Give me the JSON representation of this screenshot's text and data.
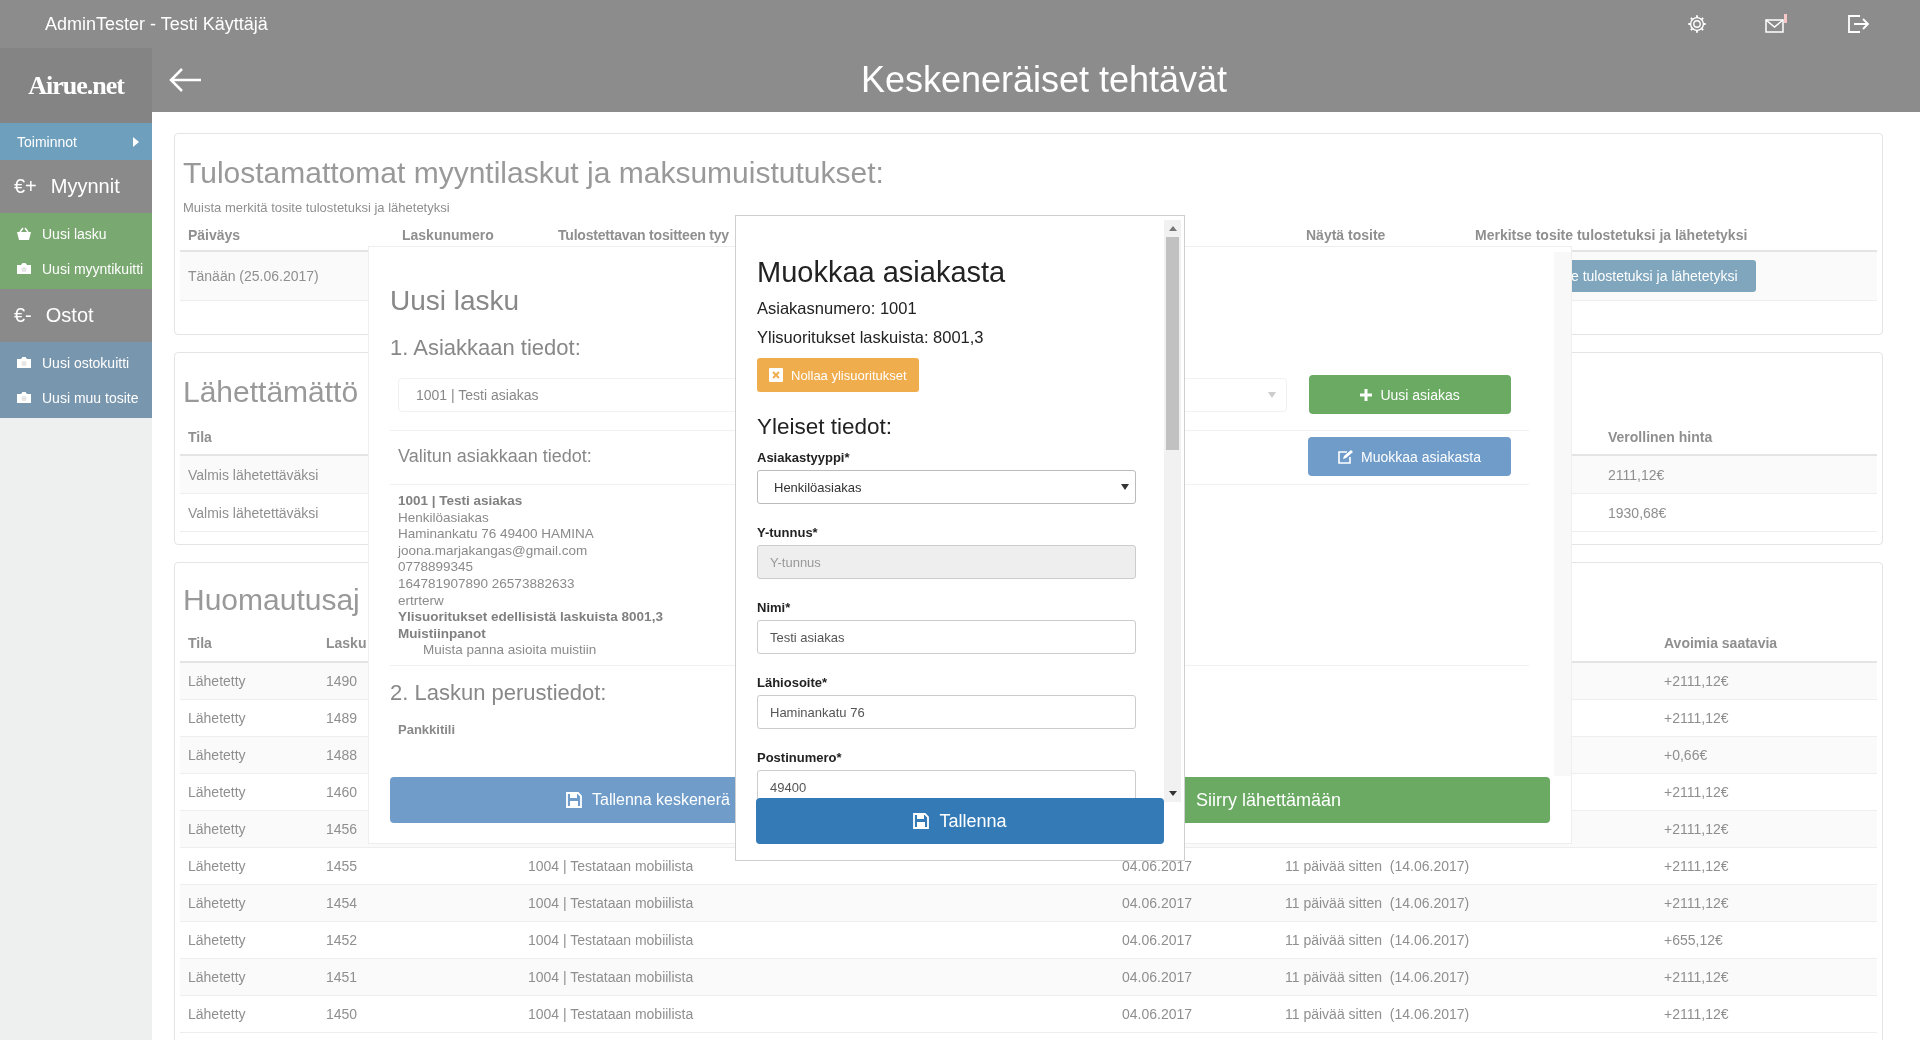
{
  "topbar": {
    "user": "AdminTester - Testi Käyttäjä",
    "mail_unread": true
  },
  "logo": "Airue.net",
  "page_title": "Keskeneräiset tehtävät",
  "sidebar": {
    "toggle": "Toiminnot",
    "groups": [
      {
        "symbol": "€+",
        "title": "Myynnit",
        "kind": "sales",
        "items": [
          {
            "label": "Uusi lasku"
          },
          {
            "label": "Uusi myyntikuitti"
          }
        ]
      },
      {
        "symbol": "€-",
        "title": "Ostot",
        "kind": "purchases",
        "items": [
          {
            "label": "Uusi ostokuitti"
          },
          {
            "label": "Uusi muu tosite"
          }
        ]
      }
    ]
  },
  "unprinted": {
    "title": "Tulostamattomat myyntilaskut ja maksumuistutukset:",
    "subtitle": "Muista merkitä tosite tulostetuksi ja lähetetyksi",
    "columns": [
      "Päiväys",
      "Laskunumero",
      "Tulostettavan tositteen tyy",
      "Näytä tosite",
      "Merkitse tosite tulostetuksi ja lähetetyksi"
    ],
    "rows": [
      {
        "date": "Tänään (25.06.2017)",
        "button": "e tulostetuksi ja lähetetyksi"
      }
    ]
  },
  "unsent": {
    "title": "Lähettämättö",
    "columns": [
      "Tila",
      "Verollinen hinta"
    ],
    "rows": [
      {
        "status": "Valmis lähetettäväksi",
        "price": "2111,12€"
      },
      {
        "status": "Valmis lähetettäväksi",
        "price": "1930,68€"
      }
    ]
  },
  "reminders": {
    "title": "Huomautusaj",
    "columns": [
      "Tila",
      "Lasku",
      "Avoimia saatavia"
    ],
    "rows": [
      {
        "status": "Lähetetty",
        "number": "1490",
        "amount": "+2111,12€"
      },
      {
        "status": "Lähetetty",
        "number": "1489",
        "amount": "+2111,12€"
      },
      {
        "status": "Lähetetty",
        "number": "1488",
        "amount": "+0,66€"
      },
      {
        "status": "Lähetetty",
        "number": "1460",
        "amount": "+2111,12€"
      },
      {
        "status": "Lähetetty",
        "number": "1456",
        "amount": "+2111,12€"
      },
      {
        "status": "Lähetetty",
        "number": "1455",
        "customer": "1004 | Testataan mobiilista",
        "date": "04.06.2017",
        "age": "11 päivää sitten  (14.06.2017)",
        "amount": "+2111,12€"
      },
      {
        "status": "Lähetetty",
        "number": "1454",
        "customer": "1004 | Testataan mobiilista",
        "date": "04.06.2017",
        "age": "11 päivää sitten  (14.06.2017)",
        "amount": "+2111,12€"
      },
      {
        "status": "Lähetetty",
        "number": "1452",
        "customer": "1004 | Testataan mobiilista",
        "date": "04.06.2017",
        "age": "11 päivää sitten  (14.06.2017)",
        "amount": "+655,12€"
      },
      {
        "status": "Lähetetty",
        "number": "1451",
        "customer": "1004 | Testataan mobiilista",
        "date": "04.06.2017",
        "age": "11 päivää sitten  (14.06.2017)",
        "amount": "+2111,12€"
      },
      {
        "status": "Lähetetty",
        "number": "1450",
        "customer": "1004 | Testataan mobiilista",
        "date": "04.06.2017",
        "age": "11 päivää sitten  (14.06.2017)",
        "amount": "+2111,12€"
      }
    ]
  },
  "invoice_dialog": {
    "title": "Uusi lasku",
    "section1": "1. Asiakkaan tiedot:",
    "customer_select": "1001 | Testi asiakas",
    "new_customer_button": "Uusi asiakas",
    "selected_heading": "Valitun asiakkaan tiedot:",
    "edit_customer_button": "Muokkaa asiakasta",
    "details": [
      {
        "text": "1001 | Testi asiakas",
        "kind": "bold"
      },
      {
        "text": "Henkilöasiakas",
        "kind": "plain"
      },
      {
        "text": "Haminankatu 76 49400 HAMINA",
        "kind": "plain"
      },
      {
        "text": "joona.marjakangas@gmail.com",
        "kind": "plain"
      },
      {
        "text": "0778899345",
        "kind": "plain"
      },
      {
        "text": "164781907890 26573882633",
        "kind": "plain"
      },
      {
        "text": "ertrterw",
        "kind": "plain"
      },
      {
        "text": "Ylisuoritukset edellisistä laskuista 8001,3",
        "kind": "bold"
      },
      {
        "text": "Muistiinpanot",
        "kind": "bold"
      },
      {
        "text": "Muista panna asioita muistiin",
        "kind": "note"
      }
    ],
    "section2": "2. Laskun perustiedot:",
    "bank_label": "Pankkitili",
    "save_draft_button": "Tallenna keskenerä",
    "send_button": "Siirry lähettämään"
  },
  "customer_dialog": {
    "title": "Muokkaa asiakasta",
    "customer_number": "Asiakasnumero: 1001",
    "overpayments": "Ylisuoritukset laskuista: 8001,3",
    "reset_button": "Nollaa ylisuoritukset",
    "section": "Yleiset tiedot:",
    "fields": [
      {
        "label": "Asiakastyyppi*",
        "kind": "select",
        "value": "Henkilöasiakas"
      },
      {
        "label": "Y-tunnus*",
        "kind": "text",
        "placeholder": "Y-tunnus",
        "disabled": true
      },
      {
        "label": "Nimi*",
        "kind": "text",
        "value": "Testi asiakas",
        "disabled": false
      },
      {
        "label": "Lähiosoite*",
        "kind": "text",
        "value": "Haminankatu 76",
        "disabled": false
      },
      {
        "label": "Postinumero*",
        "kind": "text",
        "value": "49400",
        "disabled": false
      }
    ],
    "save_button": "Tallenna"
  }
}
